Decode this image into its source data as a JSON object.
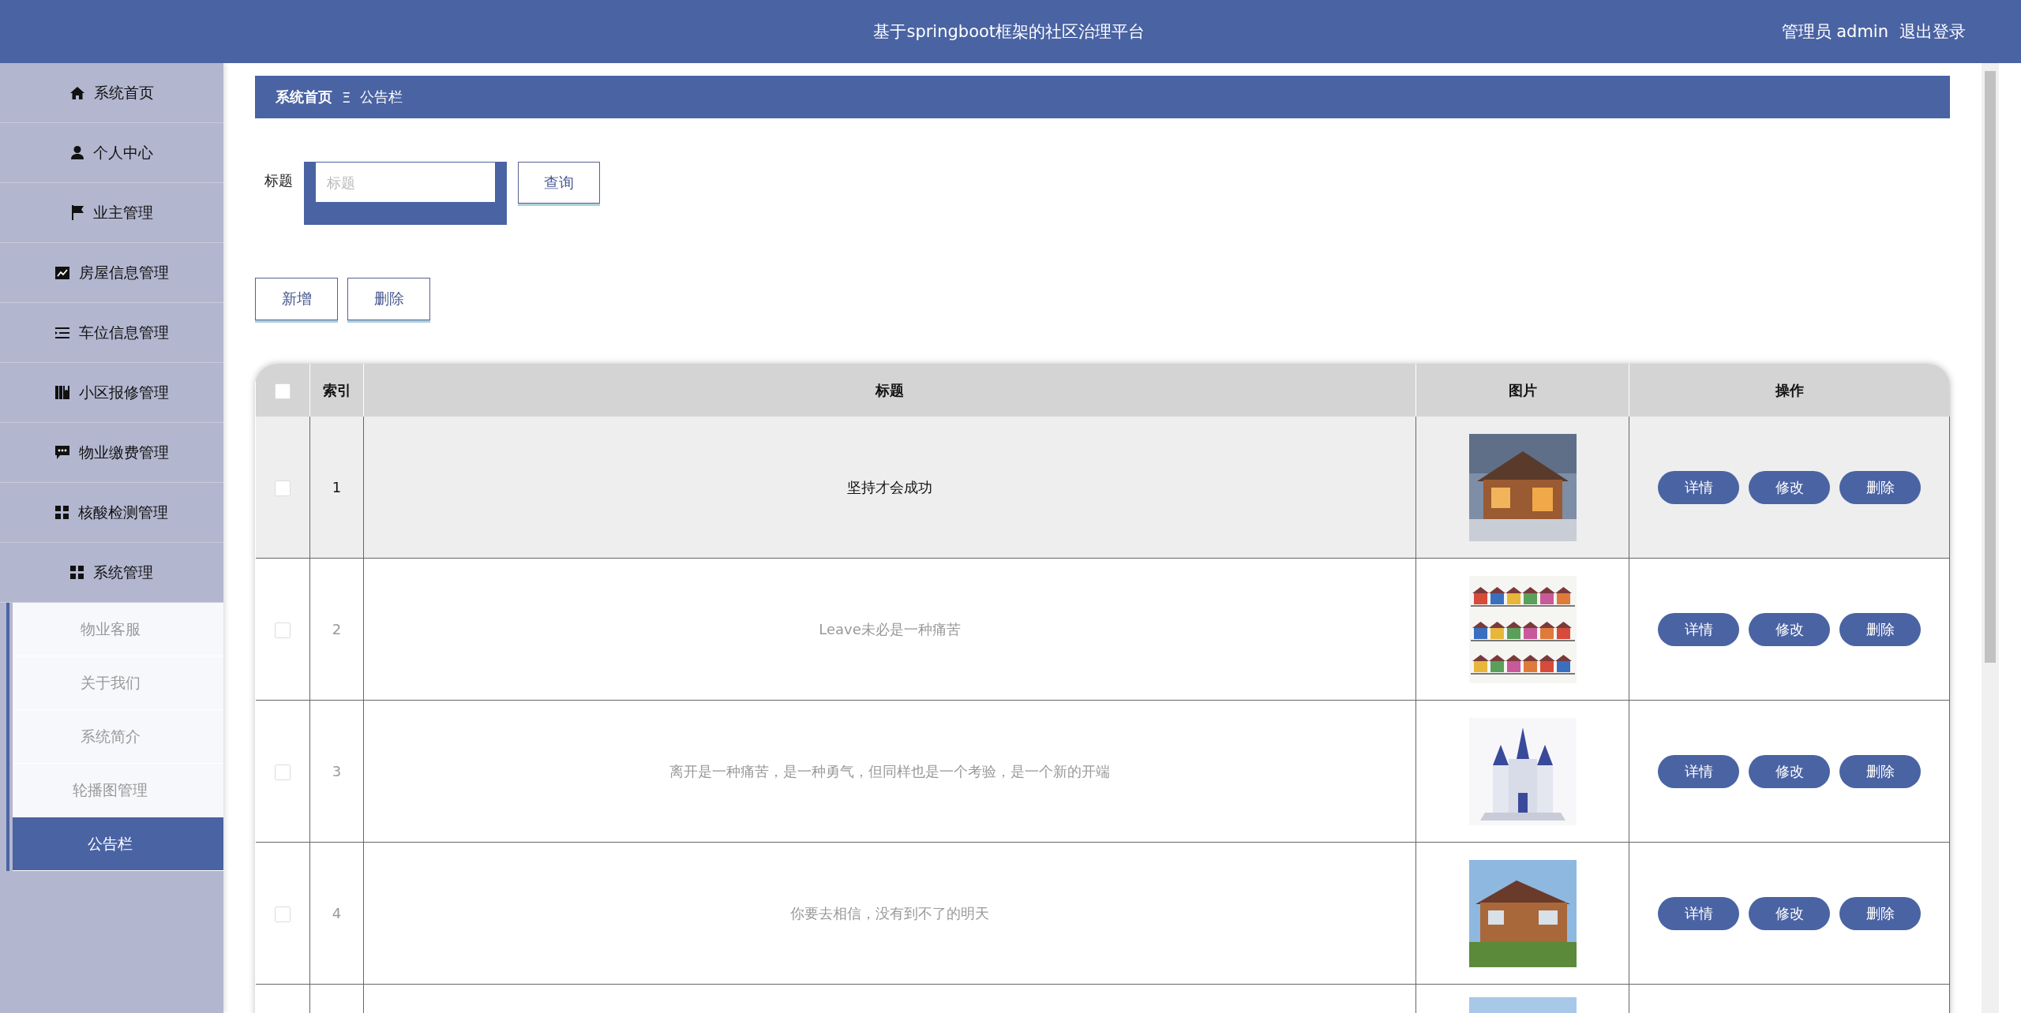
{
  "header": {
    "title": "基于springboot框架的社区治理平台",
    "user": "管理员 admin",
    "logout": "退出登录"
  },
  "sidebar": {
    "items": [
      {
        "label": "系统首页"
      },
      {
        "label": "个人中心"
      },
      {
        "label": "业主管理"
      },
      {
        "label": "房屋信息管理"
      },
      {
        "label": "车位信息管理"
      },
      {
        "label": "小区报修管理"
      },
      {
        "label": "物业缴费管理"
      },
      {
        "label": "核酸检测管理"
      },
      {
        "label": "系统管理",
        "children": [
          {
            "label": "物业客服",
            "selected": false
          },
          {
            "label": "关于我们",
            "selected": false
          },
          {
            "label": "系统简介",
            "selected": false
          },
          {
            "label": "轮播图管理",
            "selected": false
          },
          {
            "label": "公告栏",
            "selected": true
          }
        ]
      }
    ]
  },
  "breadcrumb": {
    "home": "系统首页",
    "separator": "Ξ",
    "current": "公告栏"
  },
  "search": {
    "label": "标题",
    "placeholder": "标题",
    "button": "查询"
  },
  "actions": [
    "新增",
    "删除"
  ],
  "table": {
    "columns": [
      {
        "kind": "checkbox",
        "checked": false
      },
      {
        "kind": "text",
        "label": "索引"
      },
      {
        "kind": "text",
        "label": "标题"
      },
      {
        "kind": "text",
        "label": "图片"
      },
      {
        "kind": "text",
        "label": "操作"
      }
    ],
    "rows": [
      {
        "checked": false,
        "highlighted": true,
        "index": "1",
        "title": "坚持才会成功",
        "picture": {
          "kind": "picture"
        },
        "buttons": [
          "详情",
          "修改",
          "删除"
        ]
      },
      {
        "checked": false,
        "highlighted": false,
        "index": "2",
        "title": "Leave未必是一种痛苦",
        "picture": {
          "kind": "picture"
        },
        "buttons": [
          "详情",
          "修改",
          "删除"
        ]
      },
      {
        "checked": false,
        "highlighted": false,
        "index": "3",
        "title": "离开是一种痛苦，是一种勇气，但同样也是一个考验，是一个新的开端",
        "picture": {
          "kind": "picture"
        },
        "buttons": [
          "详情",
          "修改",
          "删除"
        ]
      },
      {
        "checked": false,
        "highlighted": false,
        "index": "4",
        "title": "你要去相信，没有到不了的明天",
        "picture": {
          "kind": "picture"
        },
        "buttons": [
          "详情",
          "修改",
          "删除"
        ]
      },
      {
        "picture": {
          "kind": "picture"
        }
      }
    ]
  }
}
